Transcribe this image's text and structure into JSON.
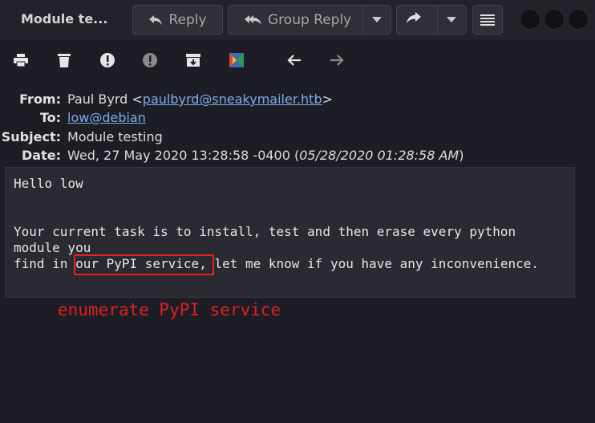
{
  "window": {
    "title": "Module te...",
    "reply_label": "Reply",
    "group_reply_label": "Group Reply"
  },
  "toolbar": {
    "icons": [
      "print-icon",
      "delete-icon",
      "junk-icon",
      "not-junk-icon",
      "archive-icon",
      "tag-icon",
      "back-arrow-icon",
      "forward-arrow-icon"
    ]
  },
  "headers": {
    "from_label": "From:",
    "from_name": "Paul Byrd <",
    "from_email": "paulbyrd@sneakymailer.htb",
    "from_suffix": ">",
    "to_label": "To:",
    "to_value": "low@debian",
    "subject_label": "Subject:",
    "subject_value": "Module testing",
    "date_label": "Date:",
    "date_value": "Wed, 27 May 2020 13:28:58 -0400 (",
    "date_local": "05/28/2020 01:28:58 AM",
    "date_suffix": ")"
  },
  "body": {
    "lines": [
      "Hello low",
      "",
      "",
      "Your current task is to install, test and then erase every python",
      "module you",
      "find in our PyPI service, let me know if you have any inconvenience."
    ]
  },
  "annotation": {
    "text": "enumerate PyPI service",
    "color": "#e01f1f"
  },
  "colors": {
    "background": "#1d1e25",
    "link": "#7fa9e8",
    "highlight": "#e62222"
  }
}
